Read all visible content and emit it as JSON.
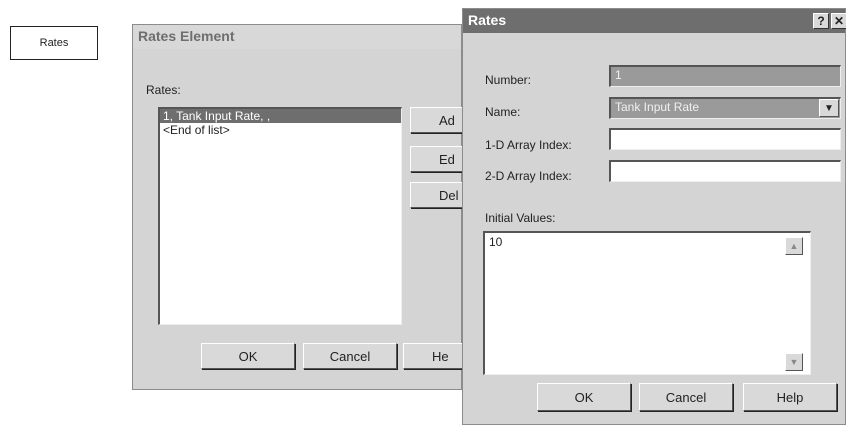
{
  "node": {
    "label": "Rates"
  },
  "rates_element_dialog": {
    "title": "Rates Element",
    "rates_label": "Rates:",
    "list_items": [
      "1, Tank Input Rate, ,",
      "<End of list>"
    ],
    "buttons": {
      "add": "Ad",
      "edit": "Ed",
      "delete": "Del",
      "ok": "OK",
      "cancel": "Cancel",
      "help": "He"
    }
  },
  "rates_dialog": {
    "title": "Rates",
    "caption_buttons": {
      "help": "?",
      "close": "✕"
    },
    "number_label": "Number:",
    "number_value": "1",
    "name_label": "Name:",
    "name_value": "Tank Input Rate",
    "index1_label": "1-D Array Index:",
    "index1_value": "",
    "index2_label": "2-D Array Index:",
    "index2_value": "",
    "initial_values_label": "Initial Values:",
    "initial_values_text": "10",
    "buttons": {
      "ok": "OK",
      "cancel": "Cancel",
      "help": "Help"
    }
  }
}
